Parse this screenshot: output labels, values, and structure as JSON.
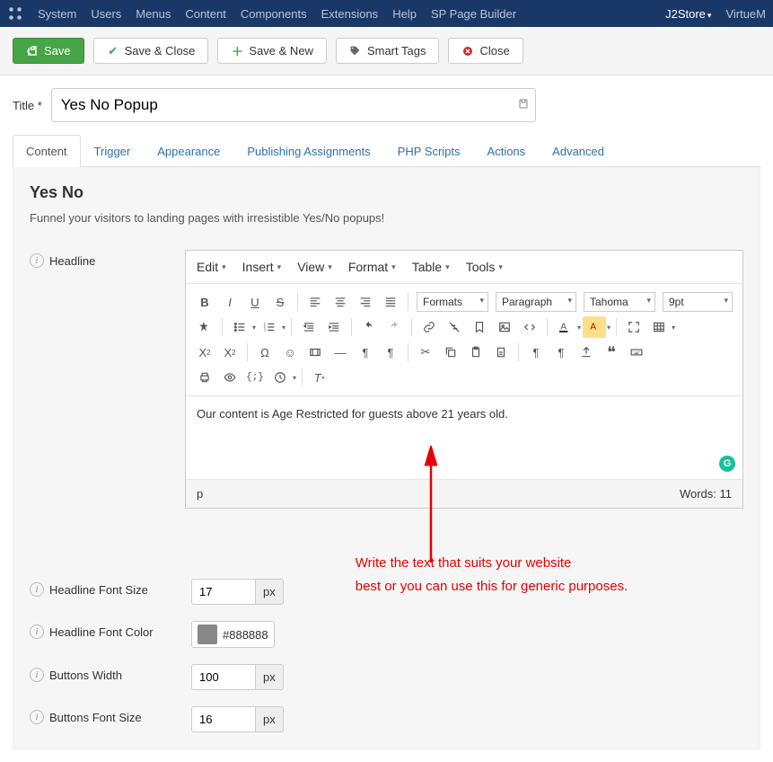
{
  "topnav": {
    "items": [
      "System",
      "Users",
      "Menus",
      "Content",
      "Components",
      "Extensions",
      "Help",
      "SP Page Builder"
    ],
    "right_items": [
      "J2Store",
      "VirtueM"
    ]
  },
  "toolbar": {
    "save": "Save",
    "save_close": "Save & Close",
    "save_new": "Save & New",
    "smart_tags": "Smart Tags",
    "close": "Close"
  },
  "title": {
    "label": "Title *",
    "value": "Yes No Popup"
  },
  "tabs": [
    "Content",
    "Trigger",
    "Appearance",
    "Publishing Assignments",
    "PHP Scripts",
    "Actions",
    "Advanced"
  ],
  "active_tab": "Content",
  "panel": {
    "heading": "Yes No",
    "desc": "Funnel your visitors to landing pages with irresistible Yes/No popups!"
  },
  "fields": {
    "headline": {
      "label": "Headline"
    },
    "headline_font_size": {
      "label": "Headline Font Size",
      "value": "17",
      "unit": "px"
    },
    "headline_font_color": {
      "label": "Headline Font Color",
      "value": "#888888"
    },
    "buttons_width": {
      "label": "Buttons Width",
      "value": "100",
      "unit": "px"
    },
    "buttons_font_size": {
      "label": "Buttons Font Size",
      "value": "16",
      "unit": "px"
    }
  },
  "editor": {
    "menus": [
      "Edit",
      "Insert",
      "View",
      "Format",
      "Table",
      "Tools"
    ],
    "selects": {
      "formats": "Formats",
      "paragraph": "Paragraph",
      "font": "Tahoma",
      "size": "9pt"
    },
    "content": "Our content is Age Restricted for guests above 21 years old.",
    "status_path": "p",
    "words_label": "Words: 11"
  },
  "annotation": {
    "line1": "Write the text that suits your website",
    "line2": "best or you can use this for generic purposes."
  }
}
